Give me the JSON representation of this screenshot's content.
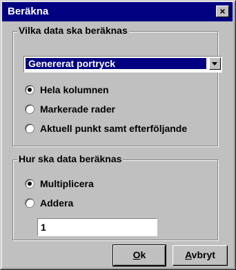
{
  "window": {
    "title": "Beräkna",
    "close_label": "×"
  },
  "group1": {
    "legend": "Vilka data ska beräknas",
    "combo_value": "Genererat portryck",
    "options": [
      {
        "label": "Hela kolumnen",
        "selected": true
      },
      {
        "label": "Markerade rader",
        "selected": false
      },
      {
        "label": "Aktuell punkt samt efterföljande",
        "selected": false
      }
    ]
  },
  "group2": {
    "legend": "Hur ska data beräknas",
    "options": [
      {
        "label": "Multiplicera",
        "selected": true
      },
      {
        "label": "Addera",
        "selected": false
      }
    ],
    "input_value": "1"
  },
  "buttons": {
    "ok_mnemonic": "O",
    "ok_rest": "k",
    "cancel_mnemonic": "A",
    "cancel_rest": "vbryt"
  }
}
